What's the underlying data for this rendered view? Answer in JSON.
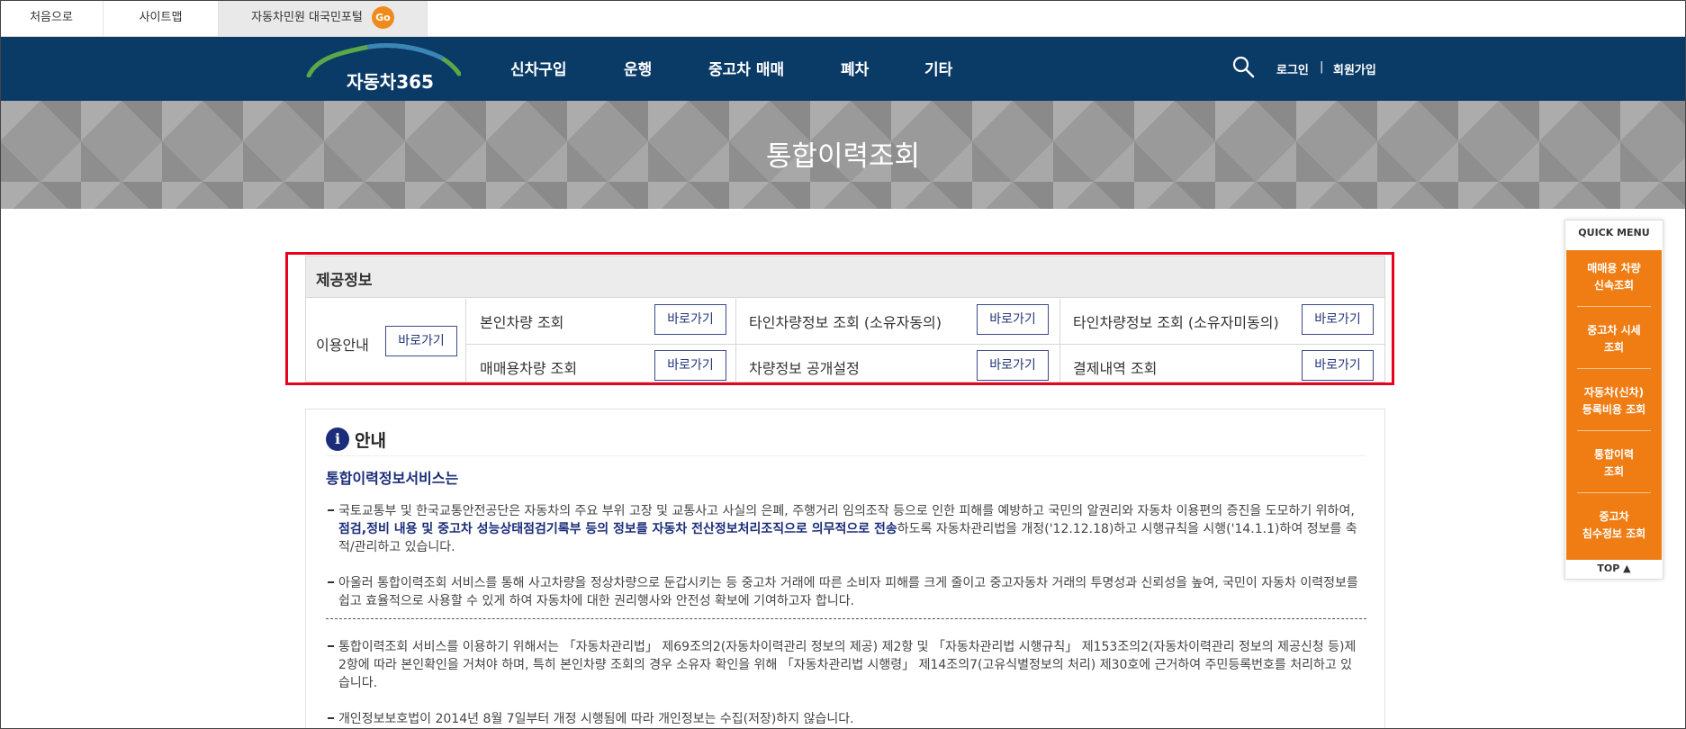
{
  "util": {
    "home": "처음으로",
    "sitemap": "사이트맵",
    "portal": "자동차민원 대국민포털",
    "go": "Go"
  },
  "nav": {
    "logo": "자동차365",
    "menu": [
      "신차구입",
      "운행",
      "중고차 매매",
      "폐차",
      "기타"
    ],
    "login": "로그인",
    "separator": "|",
    "join": "회원가입"
  },
  "banner": {
    "title": "통합이력조회"
  },
  "provided": {
    "title": "제공정보",
    "guide_label": "이용안내",
    "button_label": "바로가기",
    "items": [
      "본인차량 조회",
      "타인차량정보 조회 (소유자동의)",
      "타인차량정보 조회 (소유자미동의)",
      "매매용차량 조회",
      "차량정보 공개설정",
      "결제내역 조회"
    ]
  },
  "guide": {
    "icon": "i",
    "title": "안내",
    "subtitle": "통합이력정보서비스는",
    "p1_a": "국토교통부 및 한국교통안전공단은 자동차의 주요 부위 고장 및 교통사고 사실의 은폐, 주행거리 임의조작 등으로 인한 피해를 예방하고 국민의 알권리와 자동차 이용편의 증진을 도모하기 위하여, ",
    "p1_b": "점검,정비 내용 및 중고차 성능상태점검기록부 등의 정보를 자동차 전산정보처리조직으로 의무적으로 전송",
    "p1_c": "하도록 자동차관리법을 개정('12.12.18)하고 시행규칙을 시행('14.1.1)하여 정보를 축적/관리하고 있습니다.",
    "p2": "아울러 통합이력조회 서비스를 통해 사고차량을 정상차량으로 둔갑시키는 등 중고차 거래에 따른 소비자 피해를 크게 줄이고 중고자동차 거래의 투명성과 신뢰성을 높여, 국민이 자동차 이력정보를 쉽고 효율적으로 사용할 수 있게 하여 자동차에 대한 권리행사와 안전성 확보에 기여하고자 합니다.",
    "p3": "통합이력조회 서비스를 이용하기 위해서는 「자동차관리법」 제69조의2(자동차이력관리 정보의 제공) 제2항 및 「자동차관리법 시행규칙」 제153조의2(자동차이력관리 정보의 제공신청 등)제2항에 따라 본인확인을 거쳐야 하며, 특히 본인차량 조회의 경우 소유자 확인을 위해 「자동차관리법 시행령」 제14조의7(고유식별정보의 처리) 제30호에 근거하여 주민등록번호를 처리하고 있습니다.",
    "p4": "개인정보보호법이 2014년 8월 7일부터 개정 시행됨에 따라 개인정보는 수집(저장)하지 않습니다."
  },
  "quick_menu": {
    "title": "QUICK MENU",
    "items": [
      [
        "매매용 차량",
        "신속조회"
      ],
      [
        "중고차 시세",
        "조회"
      ],
      [
        "자동차(신차)",
        "등록비용 조회"
      ],
      [
        "통합이력",
        "조회"
      ],
      [
        "중고차",
        "침수정보 조회"
      ]
    ],
    "top": "TOP ▲"
  },
  "colors": {
    "nav": "#0a3a66",
    "accent": "#f07d14",
    "highlight": "#e8001c",
    "link": "#1b2d7a"
  },
  "icons": {
    "search": "search-icon",
    "info": "info-icon",
    "logo_arc": "car-arc-logo"
  }
}
